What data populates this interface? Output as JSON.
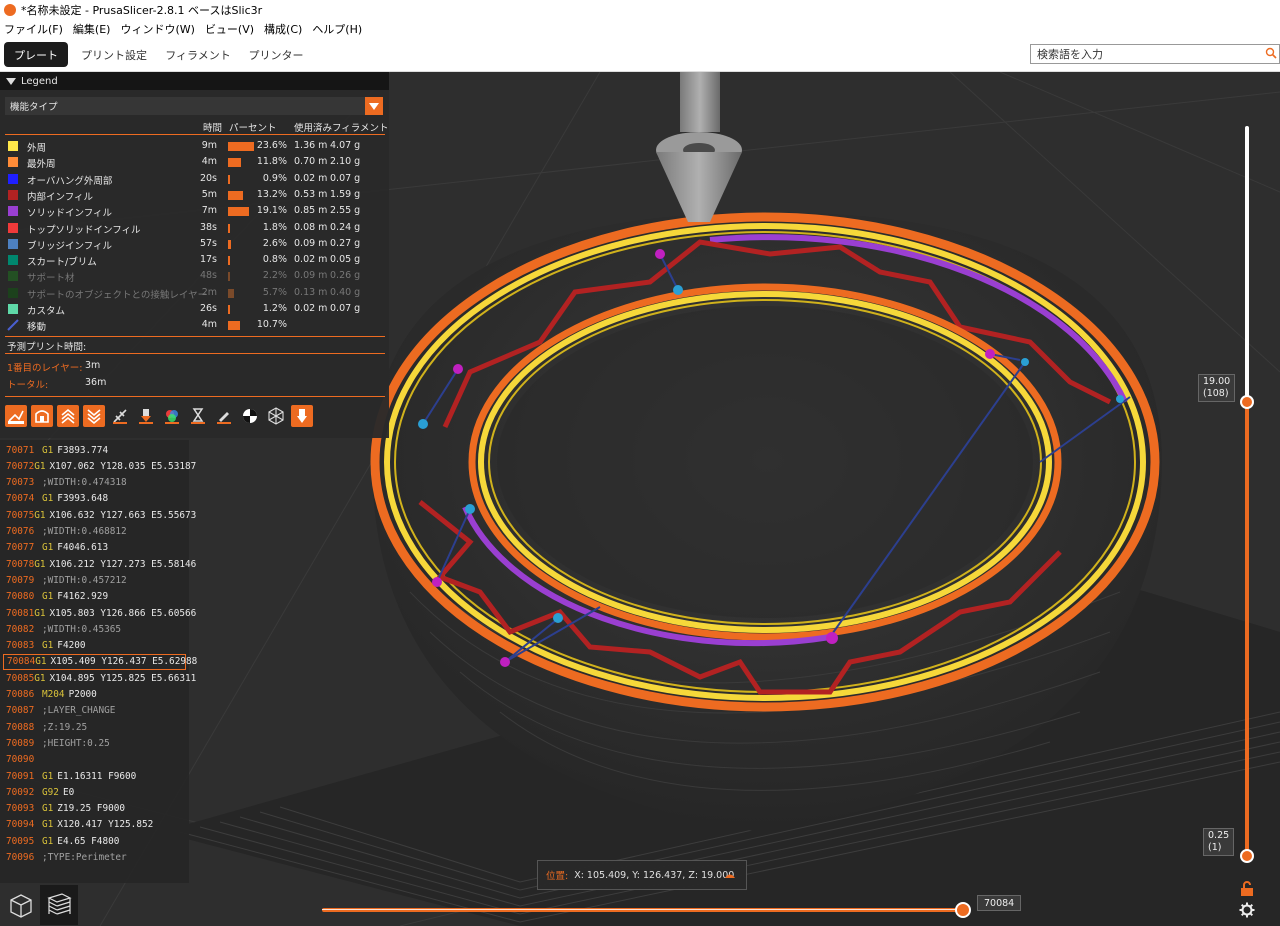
{
  "window": {
    "title": "*名称未設定 - PrusaSlicer-2.8.1 ベースはSlic3r",
    "app_icon": "prusaslicer-icon"
  },
  "menu": [
    "ファイル(F)",
    "編集(E)",
    "ウィンドウ(W)",
    "ビュー(V)",
    "構成(C)",
    "ヘルプ(H)"
  ],
  "tabs": [
    {
      "label": "プレート",
      "active": true
    },
    {
      "label": "プリント設定",
      "active": false
    },
    {
      "label": "フィラメント",
      "active": false
    },
    {
      "label": "プリンター",
      "active": false
    }
  ],
  "search": {
    "placeholder": "検索語を入力"
  },
  "legend": {
    "header": "Legend",
    "view_type": "機能タイプ",
    "columns": {
      "time": "時間",
      "percent": "パーセント",
      "used": "使用済みフィラメント"
    },
    "items": [
      {
        "name": "外周",
        "color": "#ffe84a",
        "time": "9m",
        "percent": "23.6%",
        "percent_value": 23.6,
        "length": "1.36 m",
        "weight": "4.07 g",
        "dim": false
      },
      {
        "name": "最外周",
        "color": "#ff8c38",
        "time": "4m",
        "percent": "11.8%",
        "percent_value": 11.8,
        "length": "0.70 m",
        "weight": "2.10 g",
        "dim": false
      },
      {
        "name": "オーバハング外周部",
        "color": "#1f1fff",
        "time": "20s",
        "percent": "0.9%",
        "percent_value": 0.9,
        "length": "0.02 m",
        "weight": "0.07 g",
        "dim": false
      },
      {
        "name": "内部インフィル",
        "color": "#b22222",
        "time": "5m",
        "percent": "13.2%",
        "percent_value": 13.2,
        "length": "0.53 m",
        "weight": "1.59 g",
        "dim": false
      },
      {
        "name": "ソリッドインフィル",
        "color": "#9a3fd1",
        "time": "7m",
        "percent": "19.1%",
        "percent_value": 19.1,
        "length": "0.85 m",
        "weight": "2.55 g",
        "dim": false
      },
      {
        "name": "トップソリッドインフィル",
        "color": "#f03a3a",
        "time": "38s",
        "percent": "1.8%",
        "percent_value": 1.8,
        "length": "0.08 m",
        "weight": "0.24 g",
        "dim": false
      },
      {
        "name": "ブリッジインフィル",
        "color": "#4d80c0",
        "time": "57s",
        "percent": "2.6%",
        "percent_value": 2.6,
        "length": "0.09 m",
        "weight": "0.27 g",
        "dim": false
      },
      {
        "name": "スカート/ブリム",
        "color": "#00876e",
        "time": "17s",
        "percent": "0.8%",
        "percent_value": 0.8,
        "length": "0.02 m",
        "weight": "0.05 g",
        "dim": false
      },
      {
        "name": "サポート材",
        "color": "#1f6b1f",
        "time": "48s",
        "percent": "2.2%",
        "percent_value": 2.2,
        "length": "0.09 m",
        "weight": "0.26 g",
        "dim": true
      },
      {
        "name": "サポートのオブジェクトとの接触レイヤー",
        "color": "#145214",
        "time": "2m",
        "percent": "5.7%",
        "percent_value": 5.7,
        "length": "0.13 m",
        "weight": "0.40 g",
        "dim": true
      },
      {
        "name": "カスタム",
        "color": "#5fd9a8",
        "time": "26s",
        "percent": "1.2%",
        "percent_value": 1.2,
        "length": "0.02 m",
        "weight": "0.07 g",
        "dim": false
      }
    ],
    "travel": {
      "name": "移動",
      "time": "4m",
      "percent": "10.7%",
      "percent_value": 10.7
    },
    "estimate_title": "予測プリント時間:",
    "first_layer_label": "1番目のレイヤー:",
    "first_layer_value": "3m",
    "total_label": "トータル:",
    "total_value": "36m"
  },
  "gcode": [
    {
      "ln": "70071",
      "cmd": "G1",
      "arg": "F3893.774"
    },
    {
      "ln": "70072",
      "cmd": "G1",
      "arg": "X107.062 Y128.035 E5.53187"
    },
    {
      "ln": "70073",
      "cmd": "",
      "arg": ";WIDTH:0.474318"
    },
    {
      "ln": "70074",
      "cmd": "G1",
      "arg": "F3993.648"
    },
    {
      "ln": "70075",
      "cmd": "G1",
      "arg": "X106.632 Y127.663 E5.55673"
    },
    {
      "ln": "70076",
      "cmd": "",
      "arg": ";WIDTH:0.468812"
    },
    {
      "ln": "70077",
      "cmd": "G1",
      "arg": "F4046.613"
    },
    {
      "ln": "70078",
      "cmd": "G1",
      "arg": "X106.212 Y127.273 E5.58146"
    },
    {
      "ln": "70079",
      "cmd": "",
      "arg": ";WIDTH:0.457212"
    },
    {
      "ln": "70080",
      "cmd": "G1",
      "arg": "F4162.929"
    },
    {
      "ln": "70081",
      "cmd": "G1",
      "arg": "X105.803 Y126.866 E5.60566"
    },
    {
      "ln": "70082",
      "cmd": "",
      "arg": ";WIDTH:0.45365"
    },
    {
      "ln": "70083",
      "cmd": "G1",
      "arg": "F4200"
    },
    {
      "ln": "70084",
      "cmd": "G1",
      "arg": "X105.409 Y126.437 E5.62988",
      "hl": true
    },
    {
      "ln": "70085",
      "cmd": "G1",
      "arg": "X104.895 Y125.825 E5.66311"
    },
    {
      "ln": "70086",
      "cmd": "M204",
      "arg": "P2000"
    },
    {
      "ln": "70087",
      "cmd": "",
      "arg": ";LAYER_CHANGE"
    },
    {
      "ln": "70088",
      "cmd": "",
      "arg": ";Z:19.25"
    },
    {
      "ln": "70089",
      "cmd": "",
      "arg": ";HEIGHT:0.25"
    },
    {
      "ln": "70090",
      "cmd": "",
      "arg": ""
    },
    {
      "ln": "70091",
      "cmd": "G1",
      "arg": "E1.16311 F9600"
    },
    {
      "ln": "70092",
      "cmd": "G92",
      "arg": "E0"
    },
    {
      "ln": "70093",
      "cmd": "G1",
      "arg": "Z19.25 F9000"
    },
    {
      "ln": "70094",
      "cmd": "G1",
      "arg": "X120.417 Y125.852"
    },
    {
      "ln": "70095",
      "cmd": "G1",
      "arg": "E4.65 F4800"
    },
    {
      "ln": "70096",
      "cmd": "",
      "arg": ";TYPE:Perimeter"
    }
  ],
  "position": {
    "label": "位置:",
    "value": "X: 105.409, Y: 126.437, Z: 19.000"
  },
  "horizontal_slider": {
    "value": "70084"
  },
  "vertical_slider": {
    "top_height": "19.00",
    "top_layer": "(108)",
    "bottom_height": "0.25",
    "bottom_layer": "(1)"
  },
  "colors": {
    "accent": "#ed6b21",
    "background": "#2b2b2b",
    "panel": "#2a2a2a"
  }
}
